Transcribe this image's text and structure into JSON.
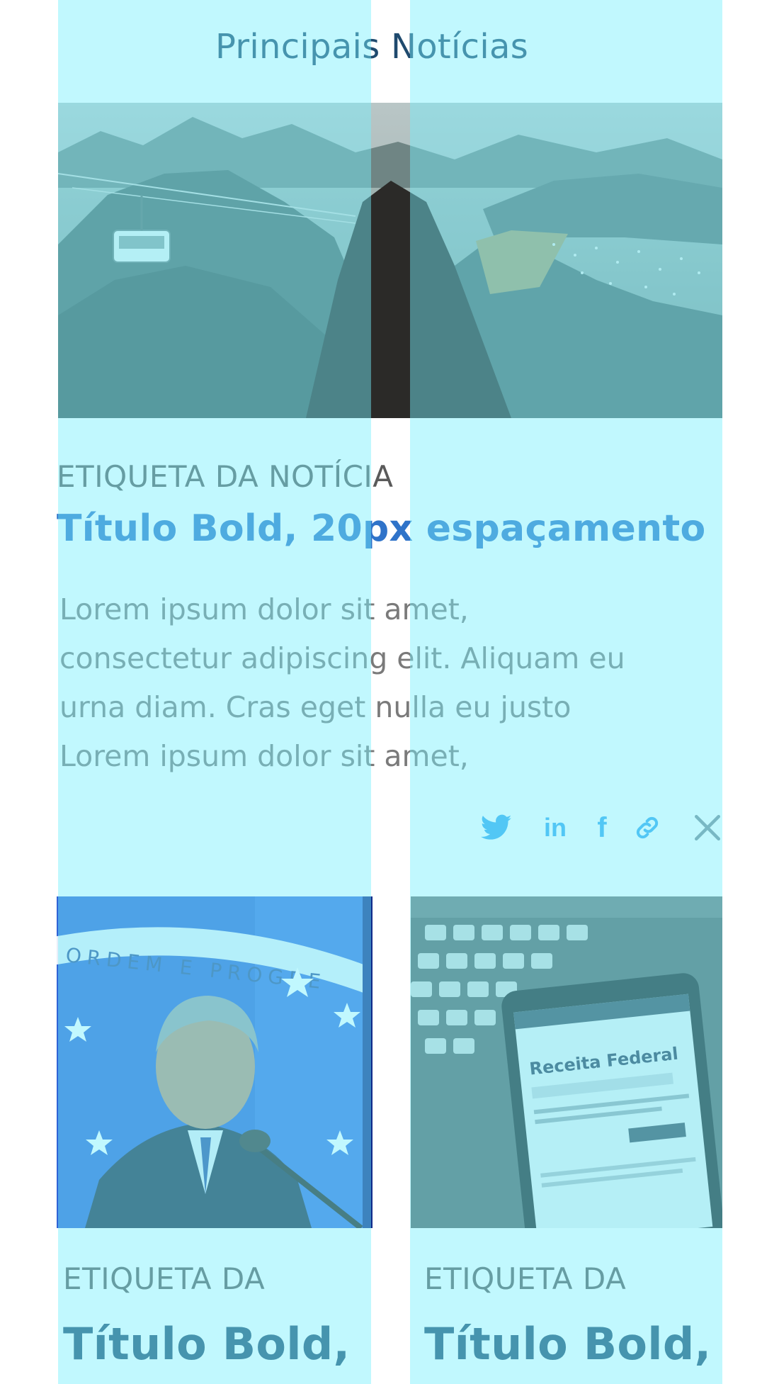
{
  "section": {
    "title": "Principais Notícias"
  },
  "featured": {
    "tag": "ETIQUETA DA NOTÍCIA",
    "title": "Título Bold, 20px espaçamento",
    "excerpt_lines": [
      "Lorem ipsum dolor sit amet,",
      "consectetur adipiscing elit. Aliquam eu",
      "urna diam. Cras eget nulla eu justo",
      "Lorem ipsum dolor sit amet,"
    ],
    "image_icon": "landscape-photo-icon"
  },
  "share": {
    "icons": [
      "twitter-icon",
      "linkedin-icon",
      "facebook-icon",
      "link-icon",
      "close-icon"
    ],
    "linkedin_glyph": "in",
    "facebook_glyph": "f"
  },
  "cards": [
    {
      "tag": "ETIQUETA DA",
      "title": "Título Bold,",
      "image_icon": "portrait-photo-icon",
      "image_text": "ORDEM E PROGRE"
    },
    {
      "tag": "ETIQUETA DA",
      "title": "Título Bold,",
      "image_icon": "phone-keyboard-photo-icon",
      "image_text": "Receita Federal"
    }
  ],
  "colors": {
    "grid_overlay": "#76f0fc",
    "title_text": "#1f4a6e",
    "featured_title": "#2f73c9",
    "tag_text": "#5a5a5a",
    "excerpt_text": "#7a7a7a",
    "share_icon": "#35a6ee"
  }
}
